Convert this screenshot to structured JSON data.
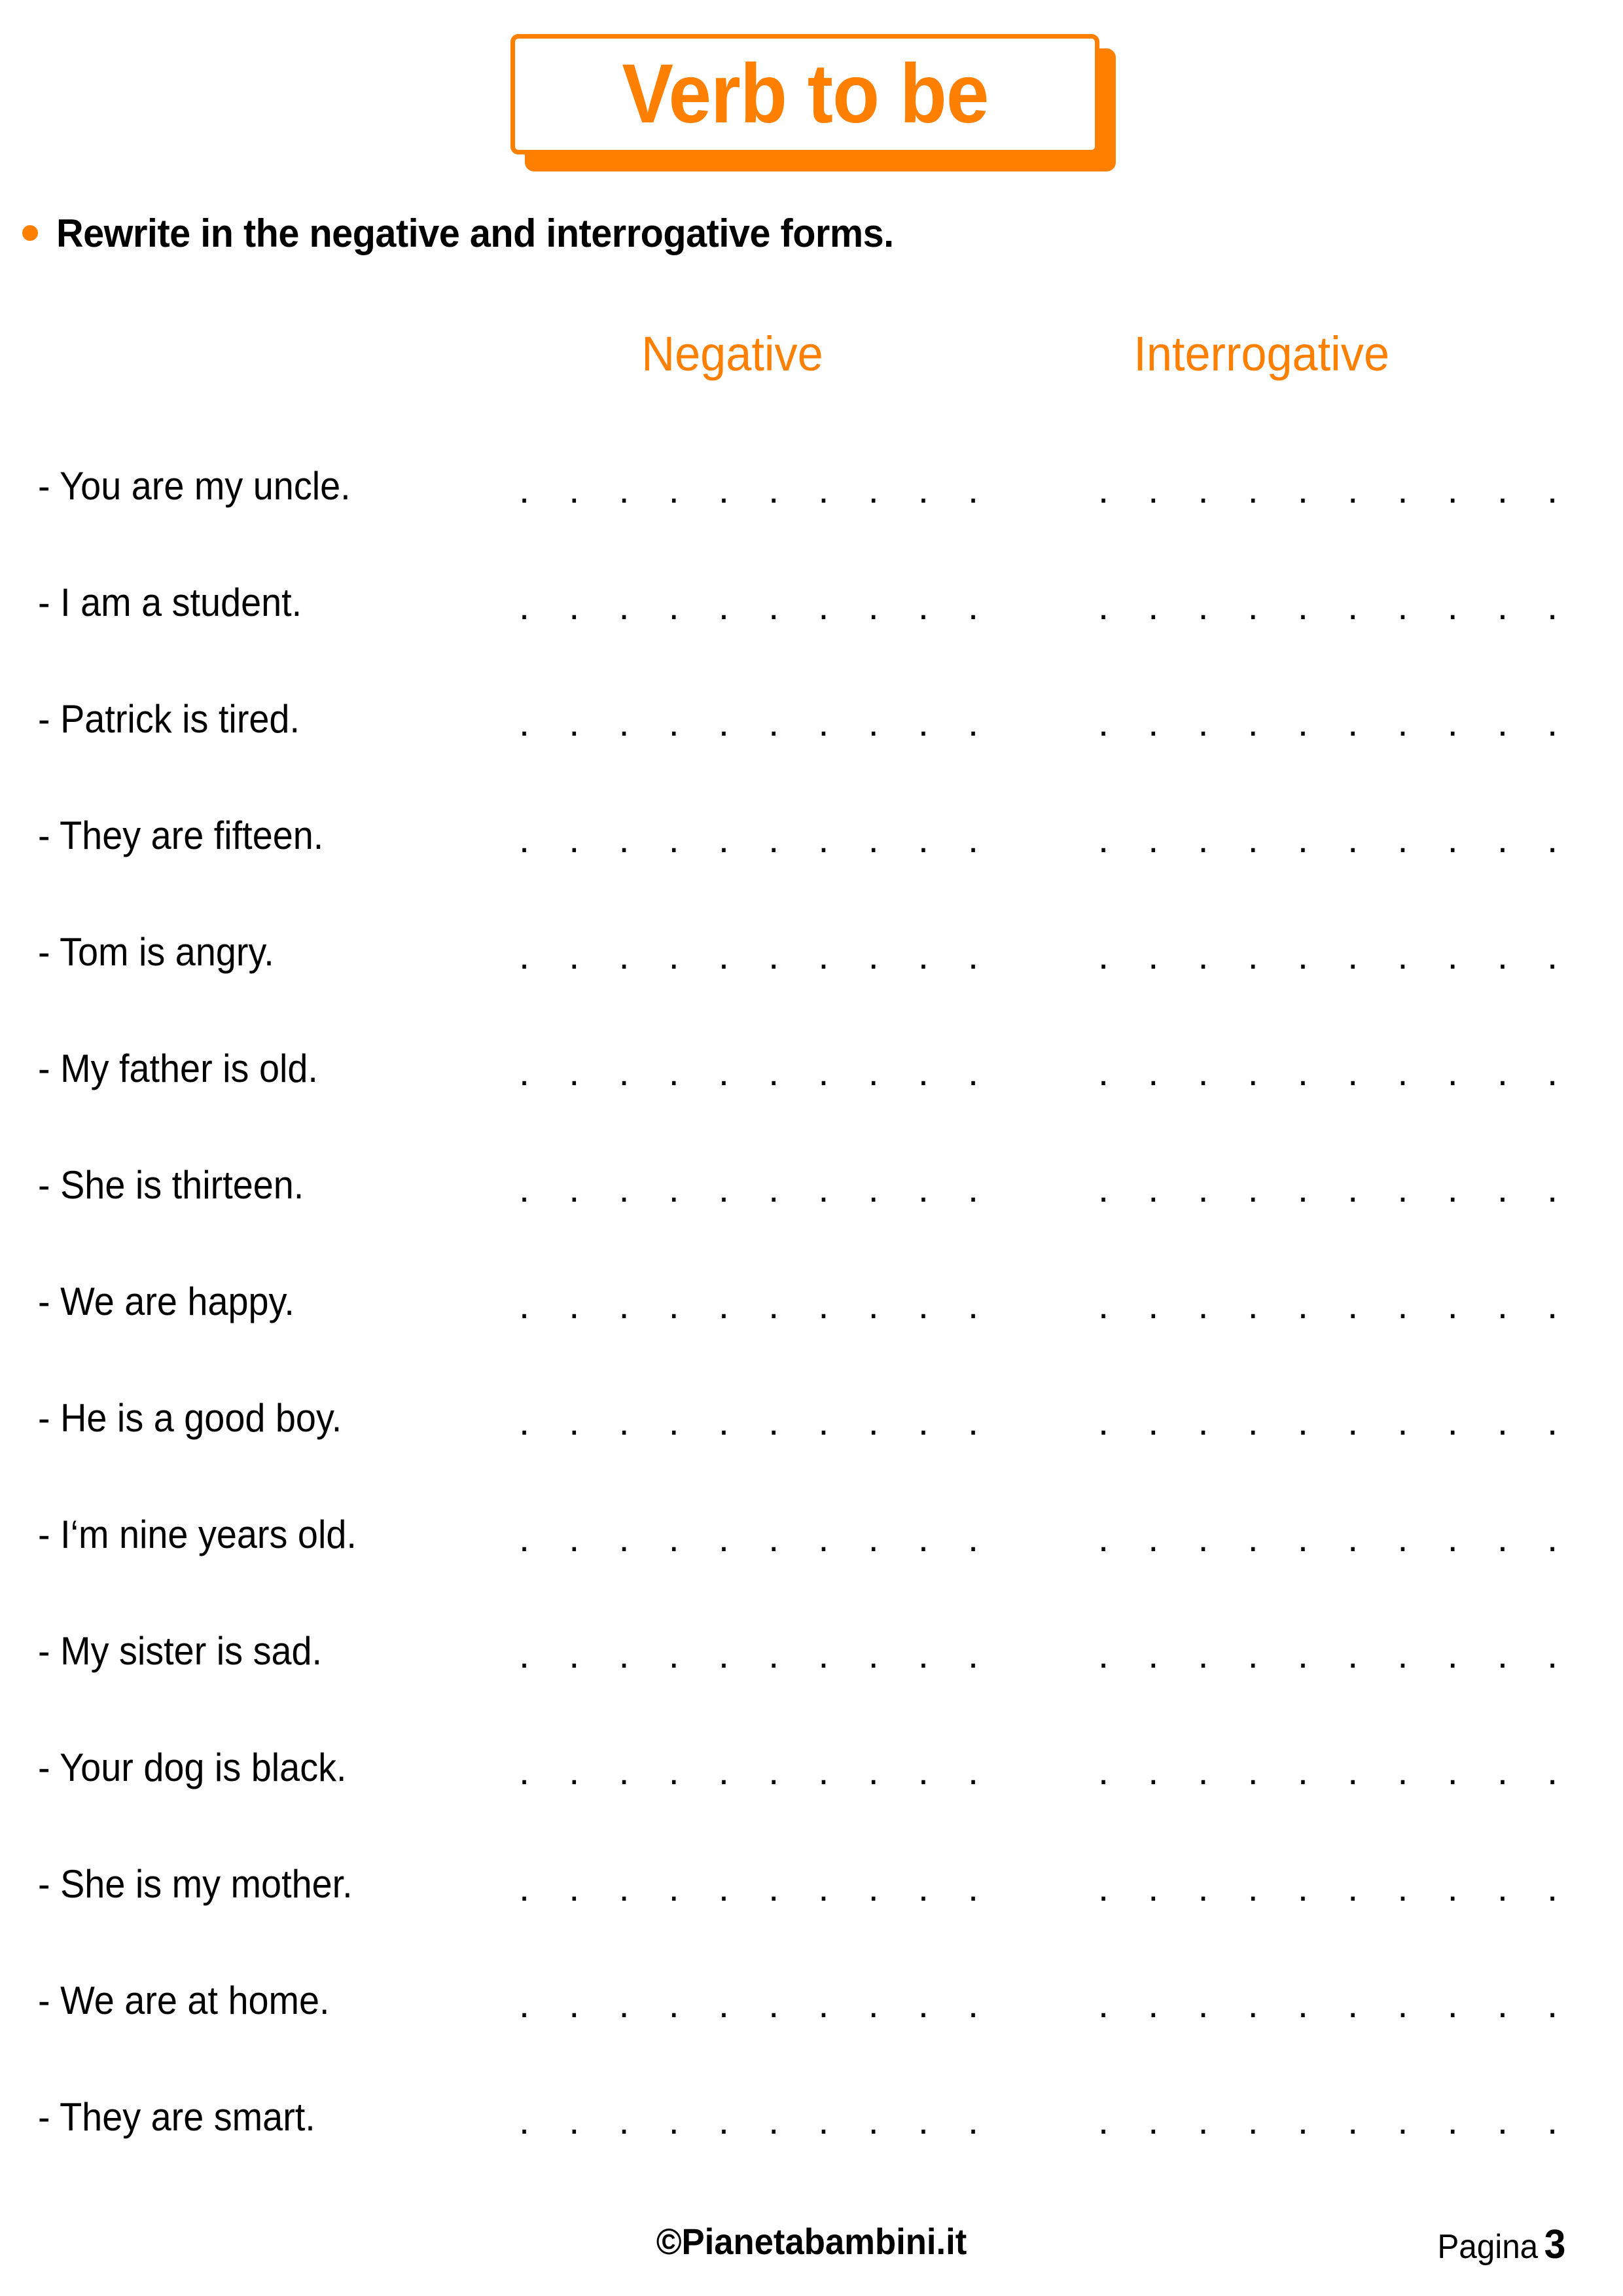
{
  "page": {
    "background_color": "#FFFFFF",
    "accent_color": "#FF7F00",
    "text_color": "#000000"
  },
  "title": {
    "text": "Verb to be"
  },
  "instruction": {
    "bullet_icon": "bullet-dot-icon",
    "text": "Rewrite in the negative and interrogative forms."
  },
  "columns": {
    "negative_label": "Negative",
    "interrogative_label": "Interrogative"
  },
  "exercises": [
    {
      "sentence": "- You are my uncle.",
      "negative_line": ". . . . . . . . . . . . . . . . . . .",
      "interrogative_line": ". . . . . . . . . . . . . . . . . . ."
    },
    {
      "sentence": "- I am a student.",
      "negative_line": ". . . . . . . . . . . . . . . . . . .",
      "interrogative_line": ". . . . . . . . . . . . . . . . . . ."
    },
    {
      "sentence": "- Patrick is tired.",
      "negative_line": ". . . . . . . . . . . . . . . . . . .",
      "interrogative_line": ". . . . . . . . . . . . . . . . . . ."
    },
    {
      "sentence": "- They are fifteen.",
      "negative_line": ". . . . . . . . . . . . . . . . . . .",
      "interrogative_line": ". . . . . . . . . . . . . . . . . . ."
    },
    {
      "sentence": "- Tom is angry.",
      "negative_line": ". . . . . . . . . . . . . . . . . . .",
      "interrogative_line": ". . . . . . . . . . . . . . . . . . ."
    },
    {
      "sentence": "- My father is old.",
      "negative_line": ". . . . . . . . . . . . . . . . . . .",
      "interrogative_line": ". . . . . . . . . . . . . . . . . . ."
    },
    {
      "sentence": "- She is thirteen.",
      "negative_line": ". . . . . . . . . . . . . . . . . . .",
      "interrogative_line": ". . . . . . . . . . . . . . . . . . ."
    },
    {
      "sentence": "- We are happy.",
      "negative_line": ". . . . . . . . . . . . . . . . . . .",
      "interrogative_line": ". . . . . . . . . . . . . . . . . . ."
    },
    {
      "sentence": "- He is a good boy.",
      "negative_line": ". . . . . . . . . . . . . . . . . . .",
      "interrogative_line": ". . . . . . . . . . . . . . . . . . ."
    },
    {
      "sentence": "- I‘m nine years old.",
      "negative_line": ". . . . . . . . . . . . . . . . . . .",
      "interrogative_line": ". . . . . . . . . . . . . . . . . . ."
    },
    {
      "sentence": "- My sister is sad.",
      "negative_line": ". . . . . . . . . . . . . . . . . . .",
      "interrogative_line": ". . . . . . . . . . . . . . . . . . ."
    },
    {
      "sentence": "- Your dog is black.",
      "negative_line": ". . . . . . . . . . . . . . . . . . .",
      "interrogative_line": ". . . . . . . . . . . . . . . . . . ."
    },
    {
      "sentence": "- She is my mother.",
      "negative_line": ". . . . . . . . . . . . . . . . . . .",
      "interrogative_line": ". . . . . . . . . . . . . . . . . . ."
    },
    {
      "sentence": "- We are at home.",
      "negative_line": ". . . . . . . . . . . . . . . . . . .",
      "interrogative_line": ". . . . . . . . . . . . . . . . . . ."
    },
    {
      "sentence": "- They are smart.",
      "negative_line": ". . . . . . . . . . . . . . . . . . .",
      "interrogative_line": ". . . . . . . . . . . . . . . . . . ."
    }
  ],
  "footer": {
    "copyright": "©Pianetabambini.it",
    "page_label": "Pagina",
    "page_number": "3"
  }
}
